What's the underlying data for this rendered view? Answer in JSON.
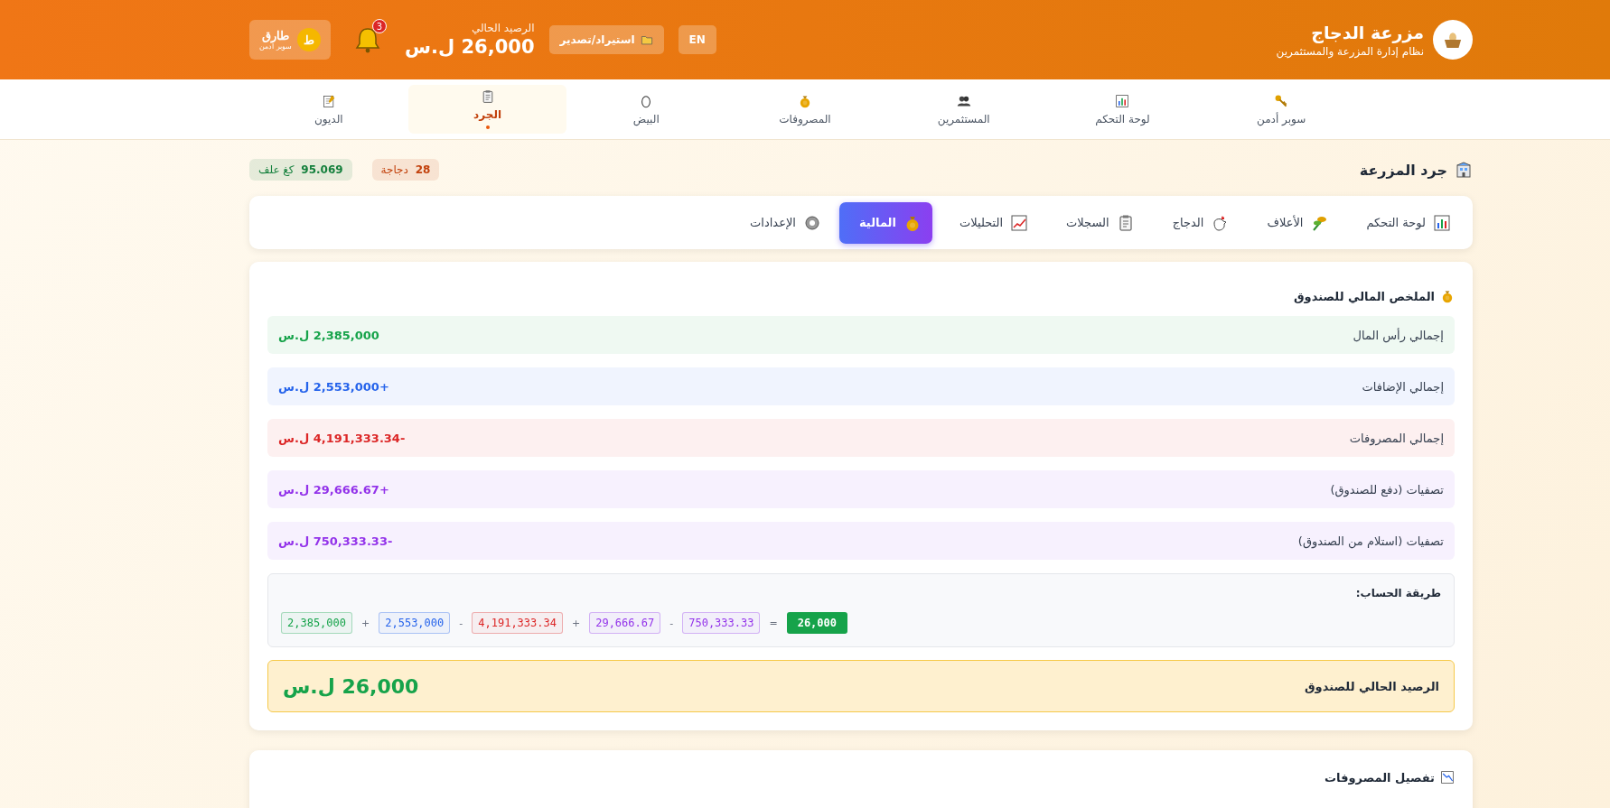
{
  "header": {
    "title": "مزرعة الدجاج",
    "subtitle": "نظام إدارة المزرعة والمستثمرين",
    "language_button": "EN",
    "import_export_button": "استيراد/تصدير",
    "balance_label": "الرصيد الحالي",
    "balance_value": "26,000 ل.س",
    "notification_count": "3",
    "user": {
      "initial": "ط",
      "name": "طارق",
      "role": "سوبر أدمن"
    }
  },
  "nav": [
    {
      "label": "سوبر أدمن",
      "selected": false
    },
    {
      "label": "لوحة التحكم",
      "selected": false
    },
    {
      "label": "المستثمرين",
      "selected": false
    },
    {
      "label": "المصروفات",
      "selected": false
    },
    {
      "label": "البيض",
      "selected": false
    },
    {
      "label": "الجرد",
      "selected": true
    },
    {
      "label": "الديون",
      "selected": false
    }
  ],
  "page": {
    "title": "جرد المزرعة",
    "badges": [
      {
        "value": "28",
        "unit": "دجاجة",
        "color": "#c2410c"
      },
      {
        "value": "95.069",
        "unit": "كغ علف",
        "color": "#15803d"
      }
    ]
  },
  "sub_tabs": [
    {
      "label": "لوحة التحكم",
      "selected": false
    },
    {
      "label": "الأعلاف",
      "selected": false
    },
    {
      "label": "الدجاج",
      "selected": false
    },
    {
      "label": "السجلات",
      "selected": false
    },
    {
      "label": "التحليلات",
      "selected": false
    },
    {
      "label": "المالية",
      "selected": true
    },
    {
      "label": "الإعدادات",
      "selected": false
    }
  ],
  "summary": {
    "title": "الملخص المالي للصندوق",
    "rows": [
      {
        "label": "إجمالي رأس المال",
        "value": "2,385,000 ل.س",
        "color": "#16a34a"
      },
      {
        "label": "إجمالي الإضافات",
        "value": "+2,553,000 ل.س",
        "color": "#2563eb"
      },
      {
        "label": "إجمالي المصروفات",
        "value": "-4,191,333.34 ل.س",
        "color": "#dc2626"
      },
      {
        "label": "تصفيات (دفع للصندوق)",
        "value": "+29,666.67 ل.س",
        "color": "#9333ea"
      },
      {
        "label": "تصفيات (استلام من الصندوق)",
        "value": "-750,333.33 ل.س",
        "color": "#9333ea"
      }
    ],
    "method_title": "طريقة الحساب:",
    "formula": [
      {
        "kind": "result",
        "text": "26,000",
        "color": "#16a34a"
      },
      {
        "kind": "op",
        "text": "="
      },
      {
        "kind": "term",
        "text": "750,333.33",
        "color": "#9333ea"
      },
      {
        "kind": "op",
        "text": "-"
      },
      {
        "kind": "term",
        "text": "29,666.67",
        "color": "#9333ea"
      },
      {
        "kind": "op",
        "text": "+"
      },
      {
        "kind": "term",
        "text": "4,191,333.34",
        "color": "#dc2626"
      },
      {
        "kind": "op",
        "text": "-"
      },
      {
        "kind": "term",
        "text": "2,553,000",
        "color": "#2563eb"
      },
      {
        "kind": "op",
        "text": "+"
      },
      {
        "kind": "term",
        "text": "2,385,000",
        "color": "#16a34a"
      }
    ],
    "total_label": "الرصيد الحالي للصندوق",
    "total_value": "26,000 ل.س"
  },
  "expenses_section": {
    "title": "تفصيل المصروفات"
  }
}
